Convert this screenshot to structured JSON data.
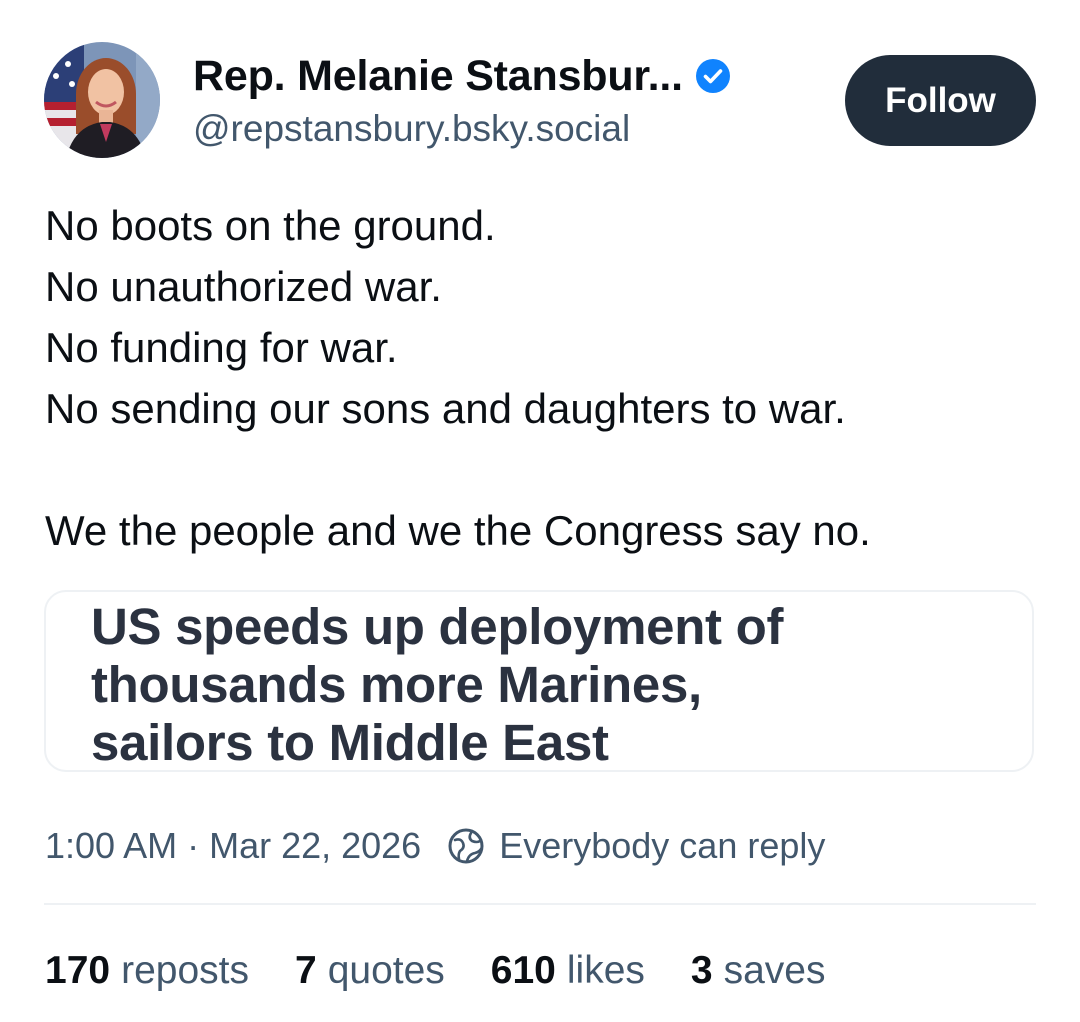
{
  "author": {
    "display_name": "Rep. Melanie Stansbur...",
    "handle": "@repstansbury.bsky.social",
    "verified": true,
    "avatar_icon": "profile-photo"
  },
  "follow_button": {
    "label": "Follow"
  },
  "post": {
    "lines": [
      "No boots on the ground.",
      "No unauthorized war.",
      "No funding for war.",
      "No sending our sons and daughters to war."
    ],
    "closing": "We the people and we the Congress say no."
  },
  "link_card": {
    "headline_lines": [
      "US speeds up deployment of",
      "thousands more Marines,",
      "sailors to Middle East"
    ]
  },
  "meta": {
    "timestamp": "1:00 AM · Mar 22, 2026",
    "reply_setting": "Everybody can reply",
    "reply_icon": "globe-icon"
  },
  "stats": [
    {
      "count": "170",
      "label": "reposts"
    },
    {
      "count": "7",
      "label": "quotes"
    },
    {
      "count": "610",
      "label": "likes"
    },
    {
      "count": "3",
      "label": "saves"
    }
  ],
  "colors": {
    "text_primary": "#0b0f14",
    "text_secondary": "#42576c",
    "follow_button_bg": "#212d3b",
    "verified_blue": "#1083fe",
    "divider": "#eef1f4"
  }
}
